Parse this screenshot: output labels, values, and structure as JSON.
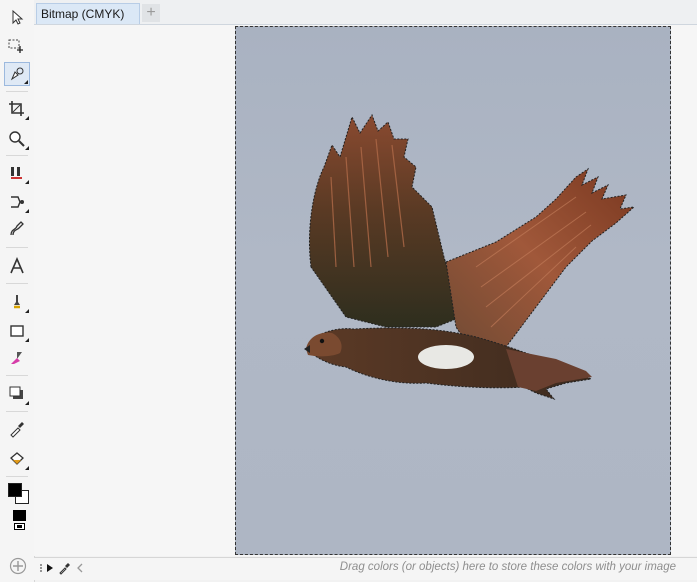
{
  "document_tab": {
    "title": "Bitmap (CMYK)",
    "add_tab_symbol": "+"
  },
  "toolbox": {
    "tools": [
      {
        "name": "pick-tool-icon"
      },
      {
        "name": "freehand-pick-icon"
      },
      {
        "name": "shape-tool-icon",
        "active": true
      },
      {
        "name": "crop-tool-icon"
      },
      {
        "name": "zoom-tool-icon"
      },
      {
        "name": "smart-fill-icon"
      },
      {
        "name": "blend-tool-icon"
      },
      {
        "name": "freehand-tool-icon"
      },
      {
        "name": "text-tool-icon"
      },
      {
        "name": "artistic-media-icon"
      },
      {
        "name": "rectangle-tool-icon"
      },
      {
        "name": "eraser-tool-icon"
      },
      {
        "name": "drop-shadow-icon"
      },
      {
        "name": "eyedropper-icon"
      },
      {
        "name": "interactive-fill-icon"
      }
    ],
    "colors": {
      "fill": "#000000",
      "outline": "#ffffff"
    }
  },
  "canvas": {
    "background_color": "#abb3c0"
  },
  "palette_bar": {
    "hint": "Drag colors (or objects) here to store these colors with your image"
  }
}
